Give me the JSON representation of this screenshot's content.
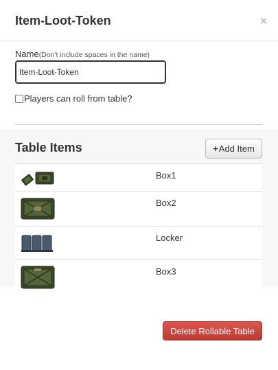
{
  "dialog": {
    "title": "Item-Loot-Token",
    "close_glyph": "×"
  },
  "form": {
    "name_label": "Name",
    "name_hint": "(Don't include spaces in the name)",
    "name_value": "Item-Loot-Token",
    "players_roll_label": "Players can roll from table?",
    "players_roll_checked": false
  },
  "table": {
    "title": "Table Items",
    "add_item_icon": "plus-icon",
    "add_item_label": "Add Item",
    "items": [
      {
        "label": "Box1",
        "icon": "box1-thumbnail"
      },
      {
        "label": "Box2",
        "icon": "box2-thumbnail"
      },
      {
        "label": "Locker",
        "icon": "locker-thumbnail"
      },
      {
        "label": "Box3",
        "icon": "box3-thumbnail"
      }
    ]
  },
  "footer": {
    "delete_label": "Delete Rollable Table"
  },
  "colors": {
    "danger": "#c9433f",
    "crate_green": "#4c5a33",
    "locker_blue": "#4a5a6c"
  }
}
